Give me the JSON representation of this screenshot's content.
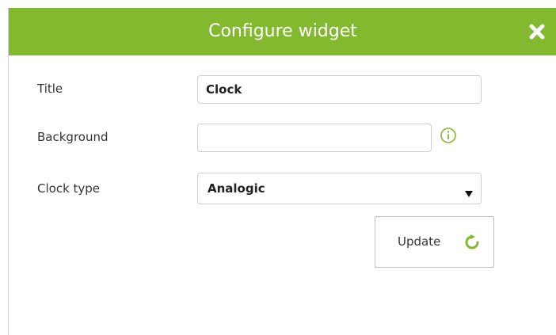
{
  "dialog": {
    "title": "Configure widget",
    "accent_color": "#82b92e",
    "close_icon": "close-icon"
  },
  "form": {
    "title_label": "Title",
    "title_value": "Clock",
    "background_label": "Background",
    "background_value": "",
    "background_info_icon": "info-icon",
    "clock_type_label": "Clock type",
    "clock_type_value": "Analogic",
    "update_label": "Update",
    "update_icon": "refresh-icon"
  }
}
